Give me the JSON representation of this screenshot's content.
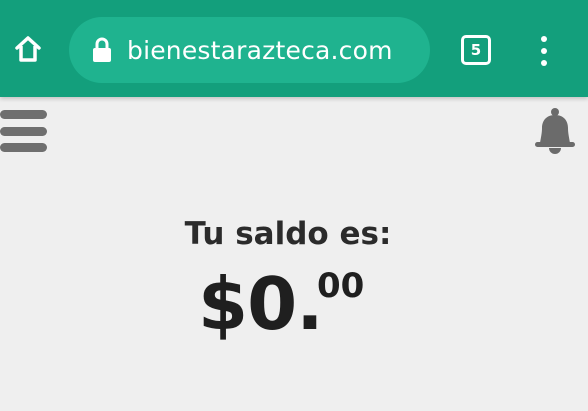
{
  "browser": {
    "url": "bienestarazteca.com",
    "tab_count": "5",
    "colors": {
      "toolbar": "#139f7c",
      "url_pill": "#1fb38f"
    }
  },
  "toolbar_icons": {
    "home": "home-icon",
    "lock": "lock-icon",
    "tabs": "tab-switcher-icon",
    "menu": "more-vertical-icon"
  },
  "page": {
    "menu_icon": "hamburger-icon",
    "notifications_icon": "bell-icon",
    "balance_label": "Tu saldo es:",
    "balance_main": "$0.",
    "balance_cents": "00"
  }
}
